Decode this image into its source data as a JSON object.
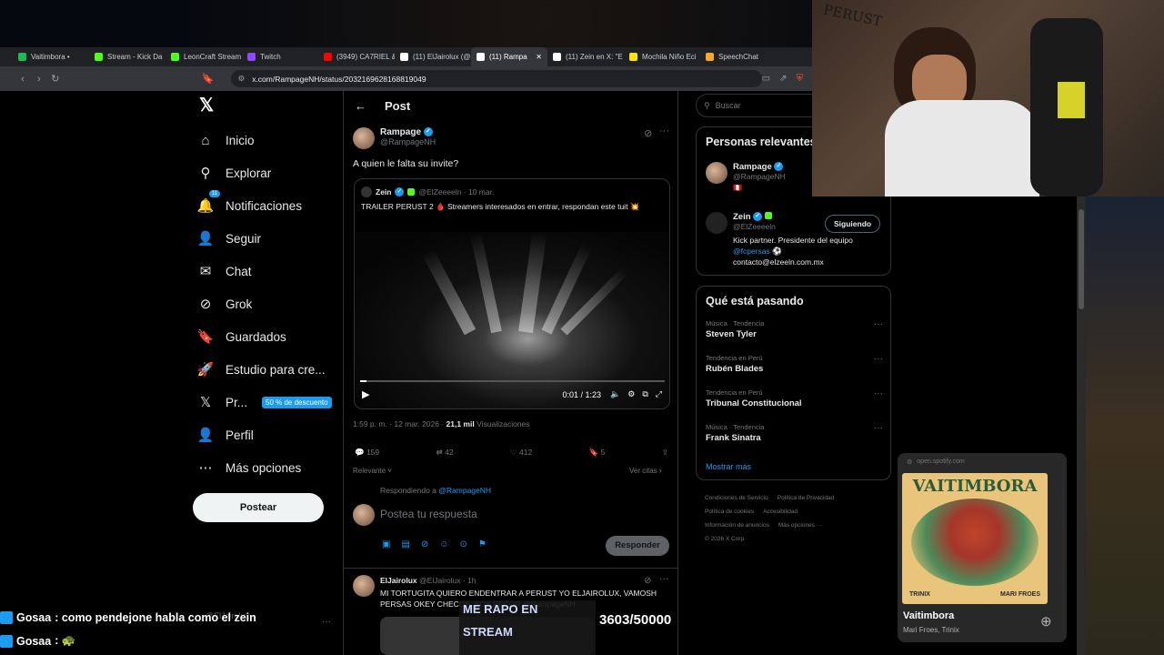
{
  "browser": {
    "tabs": [
      {
        "label": "Vaitimbora • ",
        "color": "#1db954"
      },
      {
        "label": "Stream - Kick Da",
        "color": "#53fc18"
      },
      {
        "label": "LeonCraft Stream",
        "color": "#53fc18"
      },
      {
        "label": "Twitch",
        "color": "#9146ff"
      },
      {
        "label": "(3949) CA7RIEL &",
        "color": "#ff0000"
      },
      {
        "label": "(11) ElJairolux (@",
        "color": "#ffffff"
      },
      {
        "label": "(11) Rampa",
        "color": "#ffffff",
        "active": true
      },
      {
        "label": "(11) Zein en X: \"E",
        "color": "#ffffff"
      },
      {
        "label": "Mochila Niño Eci",
        "color": "#ffe600"
      },
      {
        "label": "SpeechChat",
        "color": "#f7a825"
      }
    ],
    "url": "x.com/RampageNH/status/2032169628168819049"
  },
  "nav": {
    "items": [
      {
        "label": "Inicio",
        "icon": "home-icon",
        "glyph": "⌂"
      },
      {
        "label": "Explorar",
        "icon": "search-icon",
        "glyph": "⚲"
      },
      {
        "label": "Notificaciones",
        "icon": "bell-icon",
        "glyph": "🔔"
      },
      {
        "label": "Seguir",
        "icon": "person-add-icon",
        "glyph": "👤"
      },
      {
        "label": "Chat",
        "icon": "mail-icon",
        "glyph": "✉"
      },
      {
        "label": "Grok",
        "icon": "grok-icon",
        "glyph": "⊘"
      },
      {
        "label": "Guardados",
        "icon": "bookmark-icon",
        "glyph": "🔖"
      },
      {
        "label": "Estudio para cre...",
        "icon": "rocket-icon",
        "glyph": "🚀"
      },
      {
        "label": "Pr...",
        "icon": "x-premium-icon",
        "glyph": "𝕏"
      },
      {
        "label": "Perfil",
        "icon": "profile-icon",
        "glyph": "👤"
      },
      {
        "label": "Más opciones",
        "icon": "more-icon",
        "glyph": "⋯"
      }
    ],
    "notif_badge": "11",
    "premium_promo": "50 % de descuento",
    "post_button": "Postear",
    "mini_user": "@ElJairolux"
  },
  "post": {
    "header": "Post",
    "author_name": "Rampage",
    "author_handle": "@RampageNH",
    "text": "A quien le falta su invite?",
    "quote": {
      "author_name": "Zein",
      "author_meta": "@ElZeeeeln · 10 mar.",
      "text": "TRAILER PERUST 2 🩸 Streamers interesados en entrar, respondan este tuit 💥",
      "video_time": "0:01 / 1:23",
      "progress_fraction": 0.02
    },
    "timestamp": "1:59 p. m. · 12 mar. 2026 · ",
    "views_count": "21,1 mil",
    "views_label": " Visualizaciones",
    "stats": {
      "replies": "159",
      "reposts": "42",
      "likes": "412",
      "bookmarks": "5"
    },
    "sort_label": "Relevante",
    "quotes_link": "Ver citas",
    "replying_to_prefix": "Respondiendo a ",
    "replying_to_handle": "@RampageNH",
    "reply_placeholder": "Postea tu respuesta",
    "reply_button": "Responder"
  },
  "reply": {
    "author_name": "ElJairolux",
    "author_meta": "@ElJairolux · 1h",
    "text": "MI TORTUGITA QUIERO ENDENTRAR A PERUST YO ELJAIROLUX, VAMOSH PERSAS OKEY CHECOS, SOY RECOR @RampageNH"
  },
  "sidebar": {
    "search_placeholder": "Buscar",
    "relevant_title": "Personas relevantes",
    "people": [
      {
        "name": "Rampage",
        "handle": "@RampageNH",
        "bio": "🇵🇪"
      },
      {
        "name": "Zein",
        "handle": "@ElZeeeeln",
        "follow_label": "Siguiendo",
        "bio_line1": "Kick partner. Presidente del equipo",
        "bio_handle": "@fcpersas",
        "bio_line2": "contacto@elzeeln.com.mx"
      }
    ],
    "trending_title": "Qué está pasando",
    "trends": [
      {
        "category": "Música · Tendencia",
        "name": "Steven Tyler"
      },
      {
        "category": "Tendencia en Perú",
        "name": "Rubén Blades"
      },
      {
        "category": "Tendencia en Perú",
        "name": "Tribunal Constitucional"
      },
      {
        "category": "Música · Tendencia",
        "name": "Frank Sinatra"
      }
    ],
    "show_more": "Mostrar más",
    "footer_links": [
      "Condiciones de Servicio",
      "Política de Privacidad",
      "Política de cookies",
      "Accesibilidad",
      "Información de anuncios",
      "Más opciones ···",
      "© 2026 X Corp."
    ]
  },
  "webcam": {
    "wall_text": "PERUST"
  },
  "spotify": {
    "source": "open.spotify.com",
    "album_title": "VAITIMBORA",
    "album_artist_left": "TRINIX",
    "album_artist_right": "MARI FROES",
    "track": "Vaitimbora",
    "artists": "Mari Froes, Trinix"
  },
  "stream_chat": [
    {
      "user": "Gosaa",
      "message": " : como pendejone habla como el zein"
    },
    {
      "user": "Gosaa",
      "message": " : 🐢"
    }
  ],
  "stream_overlay": {
    "goal_text_1": "ME RAPO EN",
    "goal_text_2": "STREAM",
    "goal_progress": "3603/50000"
  }
}
